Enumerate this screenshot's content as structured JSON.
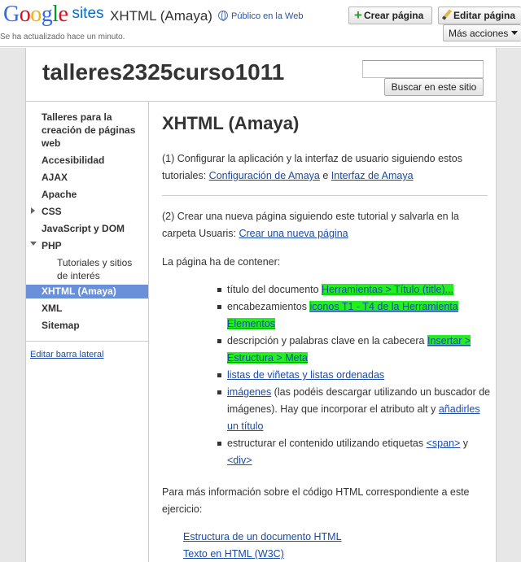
{
  "gbar": {
    "logo_google": "Google",
    "logo_sites": "sites",
    "site_title": "XHTML (Amaya)",
    "public_label": "Público en la Web",
    "updated": "Se ha actualizado hace un minuto.",
    "create_button": "Crear página",
    "edit_button": "Editar página",
    "more_button": "Más acciones"
  },
  "header": {
    "site_name": "talleres2325curso1011",
    "search_placeholder": "",
    "search_button": "Buscar en este sitio"
  },
  "sidebar": {
    "items": [
      {
        "label": "Talleres para la creación de páginas web"
      },
      {
        "label": "Accesibilidad"
      },
      {
        "label": "AJAX"
      },
      {
        "label": "Apache"
      },
      {
        "label": "CSS"
      },
      {
        "label": "JavaScript y DOM"
      },
      {
        "label": "PHP"
      },
      {
        "label": "Tutoriales y sitios de interés"
      },
      {
        "label": "XHTML (Amaya)"
      },
      {
        "label": "XML"
      },
      {
        "label": "Sitemap"
      }
    ],
    "edit_link": "Editar barra lateral"
  },
  "content": {
    "title": "XHTML (Amaya)",
    "p1_text": "(1) Configurar la aplicación y la interfaz de usuario siguiendo estos tutoriales: ",
    "p1_link1": "Configuración de Amaya",
    "p1_and": " e ",
    "p1_link2": "Interfaz de Amaya",
    "p2_text": "(2) Crear una nueva página siguiendo este tutorial y salvarla en la carpeta Usuaris: ",
    "p2_link": "Crear una nueva página",
    "p3_text": "La página ha de contener:",
    "bullets": [
      {
        "text": "título del documento ",
        "hl": "Herramientas > Título (title)..."
      },
      {
        "text": "encabezamientos ",
        "hl": "iconos T1 - T4 de la Herramienta Elementos"
      },
      {
        "text": "descripción y palabras clave en la cabecera ",
        "hl": "Insertar > Estructura > Meta"
      },
      {
        "link": "listas de viñetas y listas ordenadas"
      },
      {
        "link": "imágenes",
        "text": " (las podéis descargar utilizando un buscador de imágenes). Hay que incorporar el atributo alt y ",
        "link2": "añadirles un título"
      },
      {
        "text": "estructurar el contenido utilizando etiquetas ",
        "link": "<span>",
        "mid": " y ",
        "link2": "<div>"
      }
    ],
    "p4_text": "Para más información sobre el código HTML correspondiente a este ejercicio:",
    "refs": [
      "Estructura de un documento HTML",
      "Texto en HTML (W3C)"
    ]
  },
  "colors": {
    "accent_blue": "#6b90da",
    "link": "#1b4ba8",
    "highlight": "#22ee22"
  }
}
